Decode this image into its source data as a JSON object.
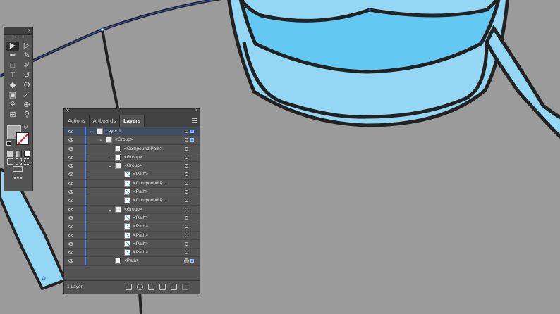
{
  "tools_panel": {
    "tools": [
      {
        "name": "selection-tool-icon",
        "glyph": "▶",
        "active": true
      },
      {
        "name": "direct-selection-tool-icon",
        "glyph": "▷"
      },
      {
        "name": "pen-tool-icon",
        "glyph": "✒"
      },
      {
        "name": "curvature-tool-icon",
        "glyph": "✎"
      },
      {
        "name": "rectangle-tool-icon",
        "glyph": "□"
      },
      {
        "name": "paintbrush-tool-icon",
        "glyph": "✐"
      },
      {
        "name": "type-tool-icon",
        "glyph": "T"
      },
      {
        "name": "rotate-tool-icon",
        "glyph": "↺"
      },
      {
        "name": "eraser-tool-icon",
        "glyph": "◆"
      },
      {
        "name": "lasso-tool-icon",
        "glyph": "ʘ"
      },
      {
        "name": "gradient-tool-icon",
        "glyph": "▣"
      },
      {
        "name": "eyedropper-tool-icon",
        "glyph": "⟋"
      },
      {
        "name": "puppet-warp-tool-icon",
        "glyph": "⚘"
      },
      {
        "name": "shape-builder-tool-icon",
        "glyph": "⊕"
      },
      {
        "name": "artboard-tool-icon",
        "glyph": "⊞"
      },
      {
        "name": "zoom-tool-icon",
        "glyph": "⚲"
      }
    ],
    "more_label": "•••",
    "fill_color": "#a9a9a9",
    "stroke_color": "#ffffff"
  },
  "layers_panel": {
    "tabs": [
      {
        "label": "Actions",
        "active": false
      },
      {
        "label": "Artboards",
        "active": false
      },
      {
        "label": "Layers",
        "active": true
      }
    ],
    "rows": [
      {
        "name": "Layer 1",
        "indent": 0,
        "disclosure": "open",
        "thumb": "group",
        "selected": true,
        "target": "empty",
        "selection_box": true
      },
      {
        "name": "<Group>",
        "indent": 1,
        "disclosure": "open",
        "thumb": "group",
        "target": "empty",
        "selection_box": true
      },
      {
        "name": "<Compound Path>",
        "indent": 2,
        "disclosure": "none",
        "thumb": "comp",
        "target": "empty"
      },
      {
        "name": "<Group>",
        "indent": 2,
        "disclosure": "closed",
        "thumb": "comp",
        "target": "empty"
      },
      {
        "name": "<Group>",
        "indent": 2,
        "disclosure": "open",
        "thumb": "group",
        "target": "empty"
      },
      {
        "name": "<Path>",
        "indent": 3,
        "disclosure": "none",
        "thumb": "path",
        "target": "empty"
      },
      {
        "name": "<Compound P...",
        "indent": 3,
        "disclosure": "none",
        "thumb": "path",
        "target": "empty"
      },
      {
        "name": "<Path>",
        "indent": 3,
        "disclosure": "none",
        "thumb": "path",
        "target": "empty"
      },
      {
        "name": "<Compound P...",
        "indent": 3,
        "disclosure": "none",
        "thumb": "path",
        "target": "empty"
      },
      {
        "name": "<Group>",
        "indent": 2,
        "disclosure": "open",
        "thumb": "group",
        "target": "empty"
      },
      {
        "name": "<Path>",
        "indent": 3,
        "disclosure": "none",
        "thumb": "path",
        "target": "empty"
      },
      {
        "name": "<Path>",
        "indent": 3,
        "disclosure": "none",
        "thumb": "path",
        "target": "empty"
      },
      {
        "name": "<Path>",
        "indent": 3,
        "disclosure": "none",
        "thumb": "path",
        "target": "empty"
      },
      {
        "name": "<Path>",
        "indent": 3,
        "disclosure": "none",
        "thumb": "path",
        "target": "empty"
      },
      {
        "name": "<Path>",
        "indent": 3,
        "disclosure": "none",
        "thumb": "path",
        "target": "empty"
      },
      {
        "name": "<Path>",
        "indent": 2,
        "disclosure": "none",
        "thumb": "comp",
        "target": "filled",
        "selection_box": true
      }
    ],
    "layer_count": "1 Layer",
    "layer_color": "#4a7ef0"
  },
  "artwork_colors": {
    "canvas": "#9b9b9b",
    "shirt_body": "#9b9b9b",
    "collar_outer": "#93d7f5",
    "collar_inner": "#63c9f2",
    "outline": "#222222",
    "selection_path": "#3a5bd0"
  }
}
